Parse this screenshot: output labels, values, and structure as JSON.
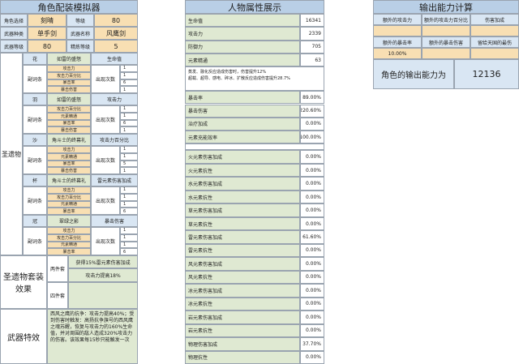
{
  "left": {
    "title": "角色配装模拟器",
    "rows": {
      "char_label": "角色选择",
      "char_value": "刻晴",
      "level_label": "等级",
      "level_value": "80",
      "wtype_label": "武器种类",
      "wtype_value": "单手剑",
      "wname_label": "武器名称",
      "wname_value": "风鹰剑",
      "wlevel_label": "武器等级",
      "wlevel_value": "80",
      "refine_label": "精炼等级",
      "refine_value": "5"
    },
    "artifact_label": "圣遗物",
    "sub_label": "副词条",
    "count_label": "出现次数",
    "pieces": [
      {
        "slot": "花",
        "set": "如雷的盛怒",
        "main": "生命值",
        "subs": [
          {
            "name": "攻击力",
            "n": "1"
          },
          {
            "name": "攻击力百分比",
            "n": "1"
          },
          {
            "name": "暴击率",
            "n": "6"
          },
          {
            "name": "暴击伤害",
            "n": "1"
          }
        ]
      },
      {
        "slot": "羽",
        "set": "如雷的盛怒",
        "main": "攻击力",
        "subs": [
          {
            "name": "攻击力百分比",
            "n": "1"
          },
          {
            "name": "元素精通",
            "n": "1"
          },
          {
            "name": "暴击率",
            "n": "6"
          },
          {
            "name": "暴击伤害",
            "n": "1"
          }
        ]
      },
      {
        "slot": "沙",
        "set": "角斗士的终幕礼",
        "main": "攻击力百分比",
        "subs": [
          {
            "name": "攻击力",
            "n": "1"
          },
          {
            "name": "元素精通",
            "n": "1"
          },
          {
            "name": "暴击率",
            "n": "5"
          },
          {
            "name": "暴击伤害",
            "n": "1"
          }
        ]
      },
      {
        "slot": "杯",
        "set": "角斗士的终幕礼",
        "main": "雷元素伤害加成",
        "subs": [
          {
            "name": "攻击力",
            "n": "1"
          },
          {
            "name": "攻击力百分比",
            "n": "1"
          },
          {
            "name": "元素精通",
            "n": "1"
          },
          {
            "name": "暴击率",
            "n": "6"
          }
        ]
      },
      {
        "slot": "冠",
        "set": "翠绿之影",
        "main": "暴击伤害",
        "subs": [
          {
            "name": "攻击力",
            "n": "1"
          },
          {
            "name": "攻击力百分比",
            "n": "1"
          },
          {
            "name": "元素精通",
            "n": "1"
          },
          {
            "name": "暴击率",
            "n": "6"
          }
        ]
      }
    ],
    "set_effect_label": "圣遗物套装效果",
    "two_piece_label": "两件套",
    "two_piece_1": "获得15%雷元素伤害加成",
    "two_piece_2": "攻击力提高18%",
    "four_piece_label": "四件套",
    "weapon_effect_label": "武器特效",
    "weapon_effect_text": "西风之鹰的抗争：攻击力提高40%；受到伤害时触发：高扬抗争旗号的西风鹰之魂苏醒，恢复与攻击力的160%生命值，并对周围的敌人造成320%攻击力的伤害。该效果每15秒只能触发一次"
  },
  "mid": {
    "title": "人物属性展示",
    "base": [
      {
        "label": "生命值",
        "value": "16341"
      },
      {
        "label": "攻击力",
        "value": "2339"
      },
      {
        "label": "防御力",
        "value": "705"
      },
      {
        "label": "元素精通",
        "value": "63"
      }
    ],
    "note1": "蒸发、融化反应造成伤害时，伤害提升12%",
    "note2": "超载、超导、感电、碎冰、扩散反应造成伤害提升28.7%",
    "stats": [
      {
        "label": "暴击率",
        "value": "89.00%"
      },
      {
        "label": "暴击伤害",
        "value": "220.60%"
      },
      {
        "label": "治疗加成",
        "value": "0.00%"
      },
      {
        "label": "元素充能效率",
        "value": "100.00%"
      }
    ],
    "elements": [
      {
        "label": "火元素伤害加成",
        "value": "0.00%"
      },
      {
        "label": "火元素抗性",
        "value": "0.00%"
      },
      {
        "label": "水元素伤害加成",
        "value": "0.00%"
      },
      {
        "label": "水元素抗性",
        "value": "0.00%"
      },
      {
        "label": "草元素伤害加成",
        "value": "0.00%"
      },
      {
        "label": "草元素抗性",
        "value": "0.00%"
      },
      {
        "label": "雷元素伤害加成",
        "value": "61.60%"
      },
      {
        "label": "雷元素抗性",
        "value": "0.00%"
      },
      {
        "label": "风元素伤害加成",
        "value": "0.00%"
      },
      {
        "label": "风元素抗性",
        "value": "0.00%"
      },
      {
        "label": "冰元素伤害加成",
        "value": "0.00%"
      },
      {
        "label": "冰元素抗性",
        "value": "0.00%"
      },
      {
        "label": "岩元素伤害加成",
        "value": "0.00%"
      },
      {
        "label": "岩元素抗性",
        "value": "0.00%"
      },
      {
        "label": "物理伤害加成",
        "value": "37.70%"
      },
      {
        "label": "物理抗性",
        "value": "0.00%"
      }
    ]
  },
  "right": {
    "title": "输出能力计算",
    "h1": "额外的攻击力",
    "h2": "额外的攻击力百分比",
    "h3": "伤害加成",
    "h4": "额外的暴击率",
    "h5": "额外的暴击伤害",
    "h6": "留给天国的最伤",
    "v4": "10.00%",
    "output_label": "角色的输出能力为",
    "output_value": "12136"
  }
}
